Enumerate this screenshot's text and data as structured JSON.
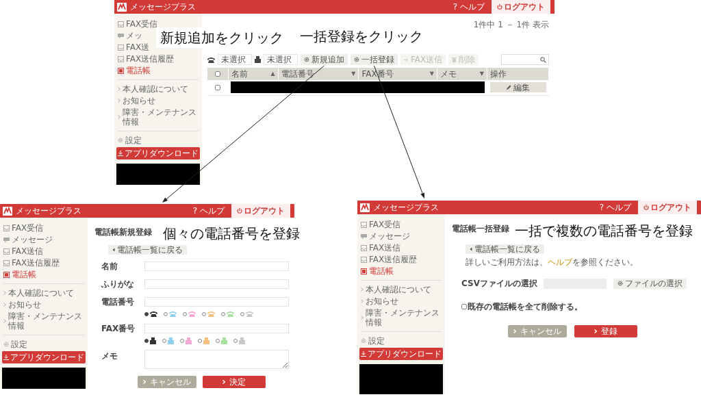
{
  "annotations": [
    {
      "text": "新規追加をクリック"
    },
    {
      "text": "一括登録をクリック"
    },
    {
      "text": "個々の電話番号を登録"
    },
    {
      "text": "一括で複数の電話番号を登録"
    }
  ],
  "screens": [
    {
      "kind": "list",
      "header": {
        "app_name": "メッセージプラス",
        "help": "? ヘルプ",
        "logout": "ログアウト"
      },
      "sidebar": {
        "sections": [
          {
            "items": [
              {
                "label": "FAX受信",
                "kind": "tray",
                "selected": false
              },
              {
                "label": "メッ",
                "kind": "chat",
                "selected": false
              },
              {
                "label": "FAX送",
                "kind": "tray",
                "selected": false
              },
              {
                "label": "FAX送信履歴",
                "kind": "tray",
                "selected": false
              },
              {
                "label": "電話帳",
                "kind": "book",
                "selected": true
              }
            ]
          },
          {
            "items": [
              {
                "label": "本人確認について",
                "kind": "link",
                "selected": false
              },
              {
                "label": "お知らせ",
                "kind": "link",
                "selected": false
              },
              {
                "label": "障害・メンテナンス情報",
                "kind": "link",
                "selected": false
              }
            ]
          },
          {
            "items": [
              {
                "label": "設定",
                "kind": "gear",
                "selected": false
              }
            ]
          }
        ],
        "download": "アプリダウンロード"
      },
      "count": "1件中 1 － 1件 表示",
      "filters": [
        {
          "kind": "phone",
          "value": "未選択"
        },
        {
          "kind": "fax",
          "value": "未選択"
        }
      ],
      "actions": [
        {
          "label": "新規追加",
          "kind": "gear",
          "disabled": false
        },
        {
          "label": "一括登録",
          "kind": "gear",
          "disabled": false
        },
        {
          "label": "FAX送信",
          "kind": "send",
          "disabled": true
        },
        {
          "label": "削除",
          "kind": "trash",
          "disabled": true
        }
      ],
      "table": {
        "select_all_checked": false,
        "columns": [
          {
            "label": "名前",
            "sort_mark": "▲"
          },
          {
            "label": "電話番号",
            "sort_mark": "▼"
          },
          {
            "label": "FAX番号",
            "sort_mark": "▼"
          },
          {
            "label": "メモ",
            "sort_mark": "▼"
          },
          {
            "label": "操作"
          }
        ],
        "rows": [
          {
            "checked": false,
            "edit": "編集"
          }
        ]
      }
    },
    {
      "kind": "form",
      "header": {
        "app_name": "メッセージプラス",
        "help": "? ヘルプ",
        "logout": "ログアウト"
      },
      "sidebar": {
        "sections": [
          {
            "items": [
              {
                "label": "FAX受信",
                "kind": "tray",
                "selected": false
              },
              {
                "label": "メッセージ",
                "kind": "chat",
                "selected": false
              },
              {
                "label": "FAX送信",
                "kind": "tray",
                "selected": false
              },
              {
                "label": "FAX送信履歴",
                "kind": "tray",
                "selected": false
              },
              {
                "label": "電話帳",
                "kind": "book",
                "selected": true
              }
            ]
          },
          {
            "items": [
              {
                "label": "本人確認について",
                "kind": "link",
                "selected": false
              },
              {
                "label": "お知らせ",
                "kind": "link",
                "selected": false
              },
              {
                "label": "障害・メンテナンス情報",
                "kind": "link",
                "selected": false
              }
            ]
          },
          {
            "items": [
              {
                "label": "設定",
                "kind": "gear",
                "selected": false
              }
            ]
          }
        ],
        "download": "アプリダウンロード"
      },
      "title": "電話帳新規登録",
      "back": "電話帳一覧に戻る",
      "fields": [
        {
          "label": "名前",
          "kind": "text"
        },
        {
          "label": "ふりがな",
          "kind": "text"
        },
        {
          "label": "電話番号",
          "kind": "phone",
          "choices": [
            {
              "color": "#333333",
              "selected": true
            },
            {
              "color": "#8fd0f0",
              "selected": false
            },
            {
              "color": "#f7a8d8",
              "selected": false
            },
            {
              "color": "#f5c080",
              "selected": false
            },
            {
              "color": "#a8e0a0",
              "selected": false
            },
            {
              "color": "#c8c8c8",
              "selected": false
            }
          ]
        },
        {
          "label": "FAX番号",
          "kind": "fax",
          "choices": [
            {
              "color": "#333333",
              "selected": true
            },
            {
              "color": "#8fd0f0",
              "selected": false
            },
            {
              "color": "#f7a8d8",
              "selected": false
            },
            {
              "color": "#f5c080",
              "selected": false
            },
            {
              "color": "#a8e0a0",
              "selected": false
            },
            {
              "color": "#c8c8c8",
              "selected": false
            }
          ]
        },
        {
          "label": "メモ",
          "kind": "textarea"
        }
      ],
      "buttons": [
        {
          "label": "キャンセル",
          "kind": "secondary"
        },
        {
          "label": "決定",
          "kind": "primary"
        }
      ]
    },
    {
      "kind": "bulk",
      "header": {
        "app_name": "メッセージプラス",
        "help": "? ヘルプ",
        "logout": "ログアウト"
      },
      "sidebar": {
        "sections": [
          {
            "items": [
              {
                "label": "FAX受信",
                "kind": "tray",
                "selected": false
              },
              {
                "label": "メッセージ",
                "kind": "chat",
                "selected": false
              },
              {
                "label": "FAX送信",
                "kind": "tray",
                "selected": false
              },
              {
                "label": "FAX送信履歴",
                "kind": "tray",
                "selected": false
              },
              {
                "label": "電話帳",
                "kind": "book",
                "selected": true
              }
            ]
          },
          {
            "items": [
              {
                "label": "本人確認について",
                "kind": "link",
                "selected": false
              },
              {
                "label": "お知らせ",
                "kind": "link",
                "selected": false
              },
              {
                "label": "障害・メンテナンス情報",
                "kind": "link",
                "selected": false
              }
            ]
          },
          {
            "items": [
              {
                "label": "設定",
                "kind": "gear",
                "selected": false
              }
            ]
          }
        ],
        "download": "アプリダウンロード"
      },
      "title": "電話帳一括登録",
      "back": "電話帳一覧に戻る",
      "help_text": {
        "before": "詳しいご利用方法は、",
        "link": "ヘルプ",
        "after": "を参照ください。"
      },
      "csv": {
        "label": "CSVファイルの選択",
        "button": "ファイルの選択"
      },
      "delete_existing": {
        "label": "既存の電話帳を全て削除する。",
        "checked": false
      },
      "buttons": [
        {
          "label": "キャンセル",
          "kind": "secondary"
        },
        {
          "label": "登録",
          "kind": "primary"
        }
      ]
    }
  ]
}
